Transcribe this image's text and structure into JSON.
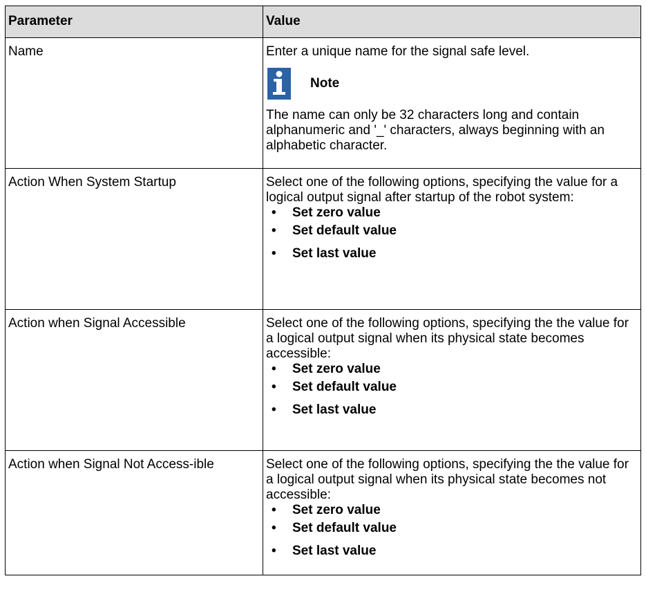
{
  "table": {
    "headers": {
      "parameter": "Parameter",
      "value": "Value"
    },
    "rows": [
      {
        "parameter": "Name",
        "intro": "Enter a unique name for the signal safe level.",
        "note_label": "Note",
        "note_text": "The name can only be 32 characters long and contain alphanumeric and '_' characters, always beginning with an alphabetic character.",
        "options": []
      },
      {
        "parameter": "Action When System Startup",
        "intro": "Select one of the following options, specifying the value for a logical output signal after startup of the robot system:",
        "options": [
          "Set zero value",
          "Set default value",
          "Set last value"
        ]
      },
      {
        "parameter": "Action when Signal Accessible",
        "intro": "Select one of the following options, specifying the the value for a logical output signal when its physical state becomes accessible:",
        "options": [
          "Set zero value",
          "Set default value",
          "Set last value"
        ]
      },
      {
        "parameter": "Action when Signal Not Access-ible",
        "intro": "Select one of the following options, specifying the the value for a logical output signal when its physical state becomes not accessible:",
        "options": [
          "Set zero value",
          "Set default value",
          "Set last value"
        ]
      }
    ]
  },
  "colors": {
    "header_bg": "#dcdcdc",
    "note_icon_bg": "#2b62a8"
  },
  "icons": {
    "note": "info-note-icon"
  }
}
